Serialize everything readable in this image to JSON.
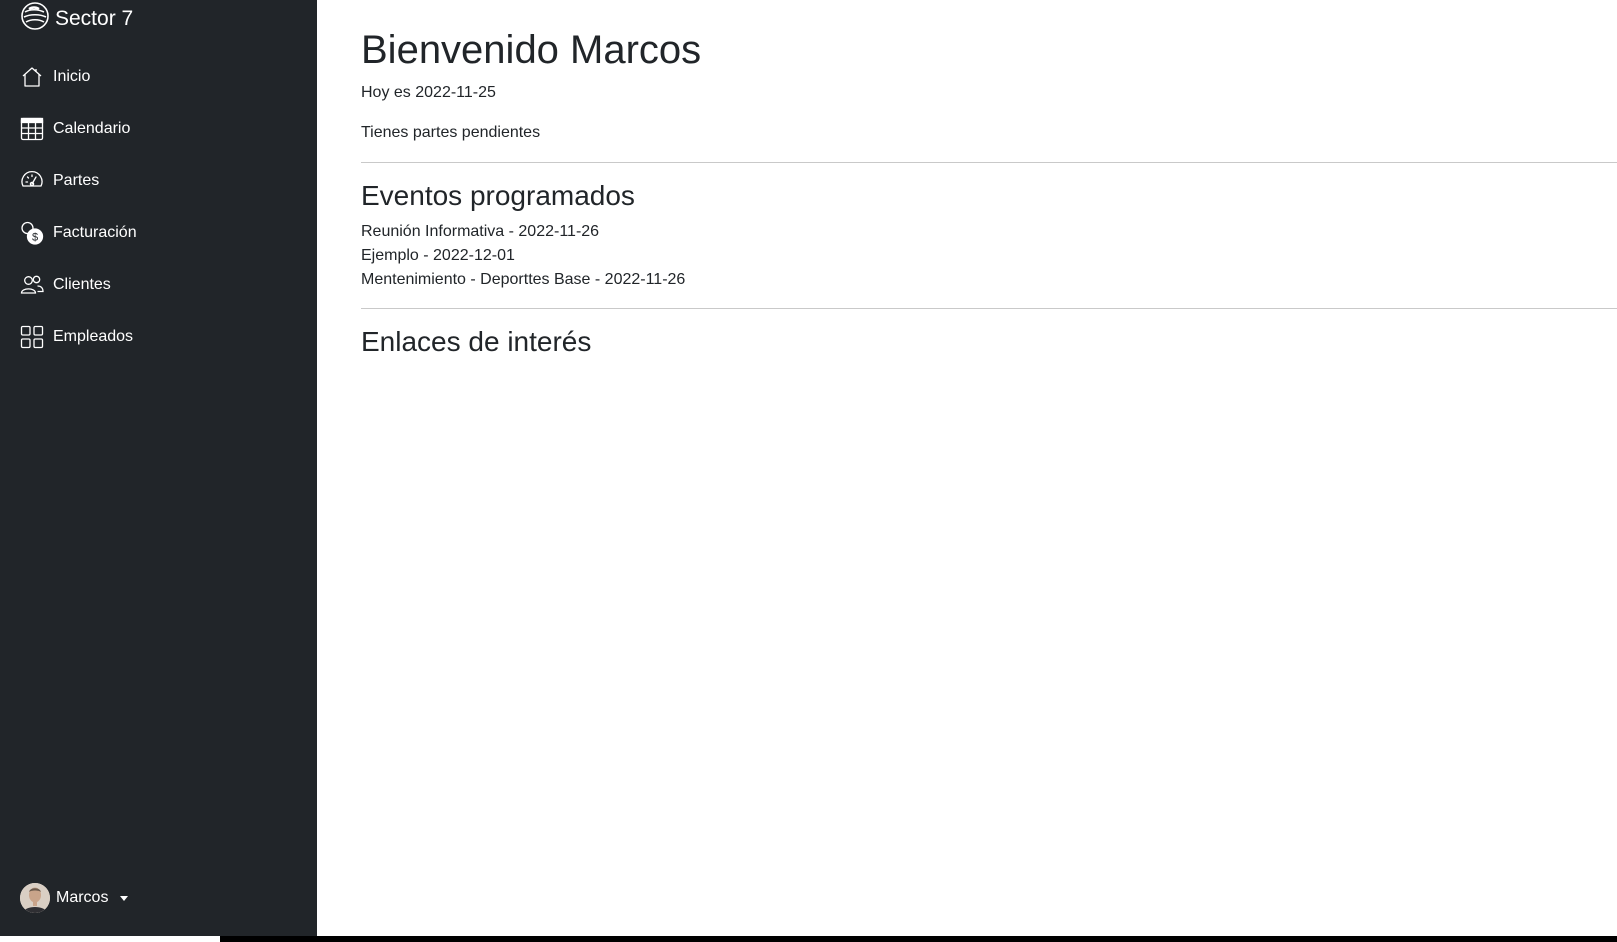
{
  "sidebar": {
    "brand": {
      "name": "Sector 7",
      "icon": "globe-logo-icon"
    },
    "items": [
      {
        "label": "Inicio",
        "icon": "house-icon"
      },
      {
        "label": "Calendario",
        "icon": "table-grid-icon"
      },
      {
        "label": "Partes",
        "icon": "speedometer-icon"
      },
      {
        "label": "Facturación",
        "icon": "coins-icon"
      },
      {
        "label": "Clientes",
        "icon": "people-icon"
      },
      {
        "label": "Empleados",
        "icon": "grid-icon"
      }
    ],
    "user": {
      "name": "Marcos"
    }
  },
  "main": {
    "title": "Bienvenido Marcos",
    "today": "Hoy es 2022-11-25",
    "pending": "Tienes partes pendientes",
    "events_heading": "Eventos programados",
    "events": [
      "Reunión Informativa - 2022-11-26",
      "Ejemplo - 2022-12-01",
      "Mentenimiento - Deporttes Base - 2022-11-26"
    ],
    "links_heading": "Enlaces de interés"
  },
  "colors": {
    "sidebar_bg": "#212529",
    "text": "#212529",
    "divider": "#c9c9c9"
  }
}
